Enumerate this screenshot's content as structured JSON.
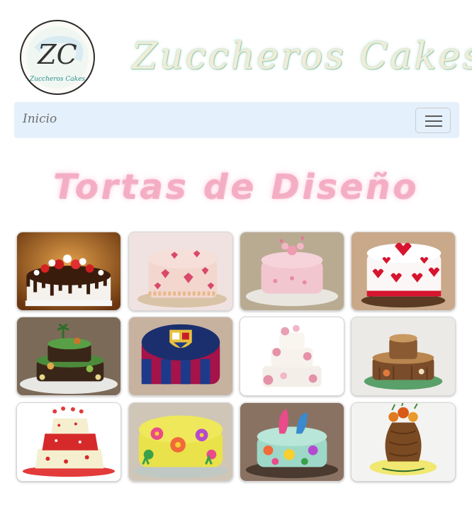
{
  "header": {
    "logo_text": "Zuccheros Cakes",
    "logo_monogram": "ZC",
    "brand": "Zuccheros Cakes"
  },
  "nav": {
    "inicio": "Inicio",
    "menu_icon": "hamburger-menu-icon"
  },
  "main": {
    "title": "Tortas de Diseño"
  },
  "gallery": {
    "items": [
      {
        "subject": "chocolate-drip-strawberry-cake"
      },
      {
        "subject": "pink-hearts-cake"
      },
      {
        "subject": "pink-flower-cake"
      },
      {
        "subject": "red-hearts-cake"
      },
      {
        "subject": "dinosaur-tiered-cake"
      },
      {
        "subject": "fc-barcelona-cake"
      },
      {
        "subject": "white-pink-flower-tiered-cake"
      },
      {
        "subject": "tree-stump-cake"
      },
      {
        "subject": "red-polka-dot-topsy-turvy-cake"
      },
      {
        "subject": "yellow-flower-cake"
      },
      {
        "subject": "trolls-flower-cake"
      },
      {
        "subject": "brown-sack-flower-cake"
      }
    ]
  },
  "colors": {
    "navbar_bg": "#e4f0fb",
    "title_pink": "#f4aec4",
    "brand_cream": "#f2ecd6",
    "brand_teal": "#8fc9b1"
  }
}
